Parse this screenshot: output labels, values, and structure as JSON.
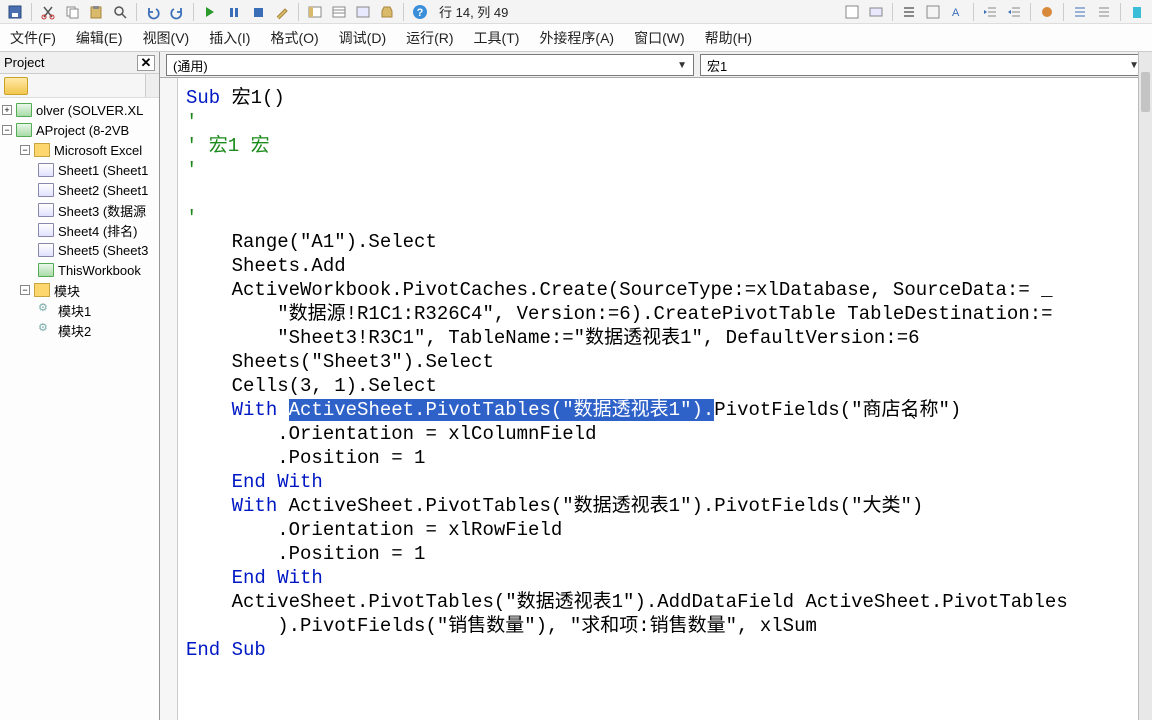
{
  "toolbar": {
    "status": "行 14, 列 49"
  },
  "menu": {
    "file": "文件(F)",
    "edit": "编辑(E)",
    "view": "视图(V)",
    "insert": "插入(I)",
    "format": "格式(O)",
    "debug": "调试(D)",
    "run": "运行(R)",
    "tools": "工具(T)",
    "addins": "外接程序(A)",
    "window": "窗口(W)",
    "help": "帮助(H)"
  },
  "project": {
    "title": "Project",
    "items": {
      "solver": "olver (SOLVER.XL",
      "vbaproj": "AProject (8-2VB",
      "excel": "Microsoft Excel",
      "sheet1": "Sheet1 (Sheet1",
      "sheet2": "Sheet2 (Sheet1",
      "sheet3": "Sheet3 (数据源",
      "sheet4": "Sheet4 (排名)",
      "sheet5": "Sheet5 (Sheet3",
      "thiswb": "ThisWorkbook",
      "modules": "模块",
      "mod1": "模块1",
      "mod2": "模块2"
    }
  },
  "dropdowns": {
    "left": "(通用)",
    "right": "宏1"
  },
  "code": {
    "l1a": "Sub",
    "l1b": " 宏1()",
    "l2": "'",
    "l3": "' 宏1 宏",
    "l4": "'",
    "l5": "",
    "l6": "'",
    "l7": "    Range(\"A1\").Select",
    "l8": "    Sheets.Add",
    "l9": "    ActiveWorkbook.PivotCaches.Create(SourceType:=xlDatabase, SourceData:= _",
    "l10": "        \"数据源!R1C1:R326C4\", Version:=6).CreatePivotTable TableDestination:=",
    "l11": "        \"Sheet3!R3C1\", TableName:=\"数据透视表1\", DefaultVersion:=6",
    "l12": "    Sheets(\"Sheet3\").Select",
    "l13": "    Cells(3, 1).Select",
    "l14a": "    ",
    "l14kw": "With",
    "l14b": " ",
    "l14sel": "ActiveSheet.PivotTables(\"数据透视表1\").",
    "l14c": "PivotFields(\"商店名称\")",
    "l15": "        .Orientation = xlColumnField",
    "l16": "        .Position = 1",
    "l17a": "    ",
    "l17kw": "End With",
    "l18a": "    ",
    "l18kw": "With",
    "l18b": " ActiveSheet.PivotTables(\"数据透视表1\").PivotFields(\"大类\")",
    "l19": "        .Orientation = xlRowField",
    "l20": "        .Position = 1",
    "l21a": "    ",
    "l21kw": "End With",
    "l22": "    ActiveSheet.PivotTables(\"数据透视表1\").AddDataField ActiveSheet.PivotTables",
    "l23": "        ).PivotFields(\"销售数量\"), \"求和项:销售数量\", xlSum",
    "l24": "End Sub"
  }
}
